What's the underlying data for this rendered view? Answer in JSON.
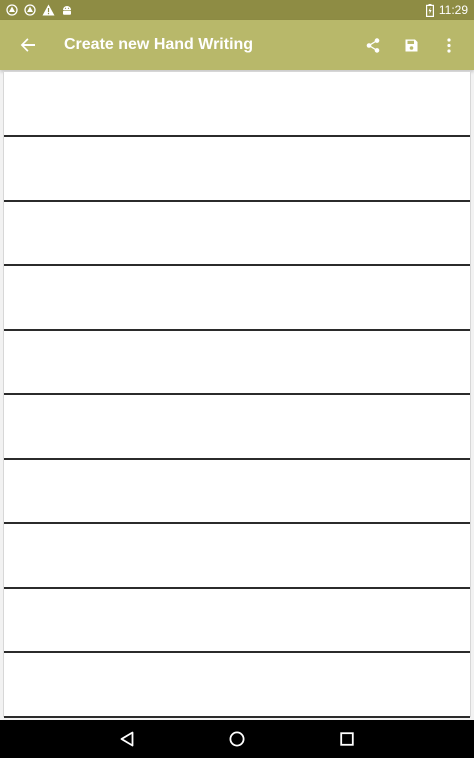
{
  "status_bar": {
    "left_icons": [
      "app-notification-icon",
      "app-notification-icon",
      "warning-icon",
      "android-icon"
    ],
    "time": "11:29",
    "battery_icon": "battery-icon"
  },
  "toolbar": {
    "title": "Create new Hand Writing",
    "back_icon": "arrow-back-icon",
    "action_icons": [
      "share-icon",
      "save-icon",
      "overflow-menu-icon"
    ]
  },
  "canvas": {
    "ruled_lines": 10
  },
  "navigation": {
    "buttons": [
      "back-triangle-icon",
      "home-circle-icon",
      "recents-square-icon"
    ]
  },
  "colors": {
    "status_bar": "#8e8c44",
    "toolbar": "#b8b86a",
    "canvas": "#ffffff",
    "rule_line": "#2b2b2b",
    "nav_bar": "#000000"
  }
}
